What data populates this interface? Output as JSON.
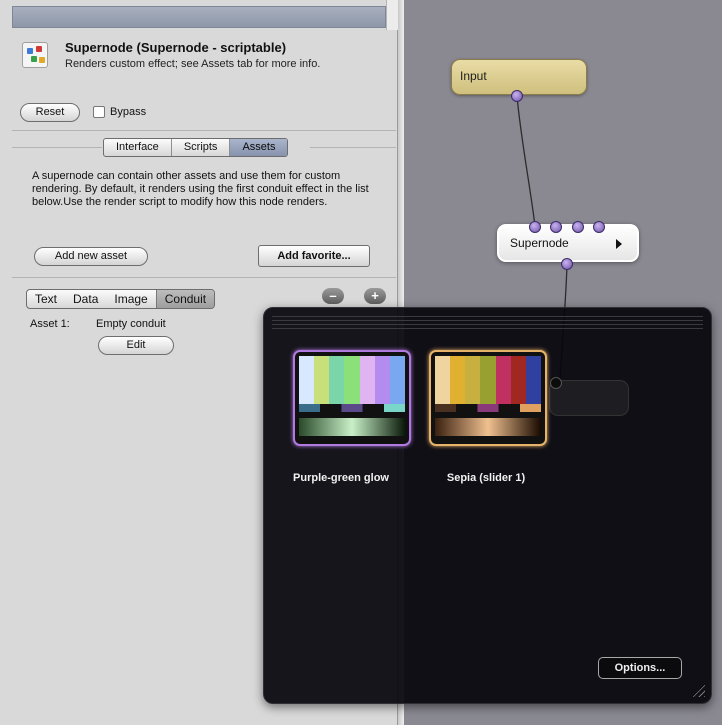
{
  "inspector": {
    "node_title": "Supernode (Supernode - scriptable)",
    "node_description": "Renders custom effect; see Assets tab for more info.",
    "reset_label": "Reset",
    "bypass_label": "Bypass",
    "bypass_checked": false,
    "tabs": [
      {
        "label": "Interface",
        "active": false
      },
      {
        "label": "Scripts",
        "active": false
      },
      {
        "label": "Assets",
        "active": true
      }
    ],
    "assets_description": "A supernode can contain other assets and use them for custom rendering. By default, it renders using the first conduit effect in the list below.Use the render script to modify how this node renders.",
    "add_new_asset_label": "Add new asset",
    "add_favorite_label": "Add favorite...",
    "asset_types": [
      {
        "label": "Text",
        "active": false
      },
      {
        "label": "Data",
        "active": false
      },
      {
        "label": "Image",
        "active": false
      },
      {
        "label": "Conduit",
        "active": true
      }
    ],
    "remove_label": "–",
    "add_label": "+",
    "asset_row": {
      "label": "Asset 1:",
      "value": "Empty conduit"
    },
    "edit_label": "Edit"
  },
  "graph": {
    "input_node_label": "Input",
    "supernode_label": "Supernode",
    "input_node_color": "#ddd090",
    "port_color": "#9b7fd6"
  },
  "favorites": {
    "items": [
      {
        "caption": "Purple-green glow",
        "border_color": "#b17ae0"
      },
      {
        "caption": "Sepia (slider 1)",
        "border_color": "#e7b36a"
      }
    ],
    "options_label": "Options..."
  }
}
